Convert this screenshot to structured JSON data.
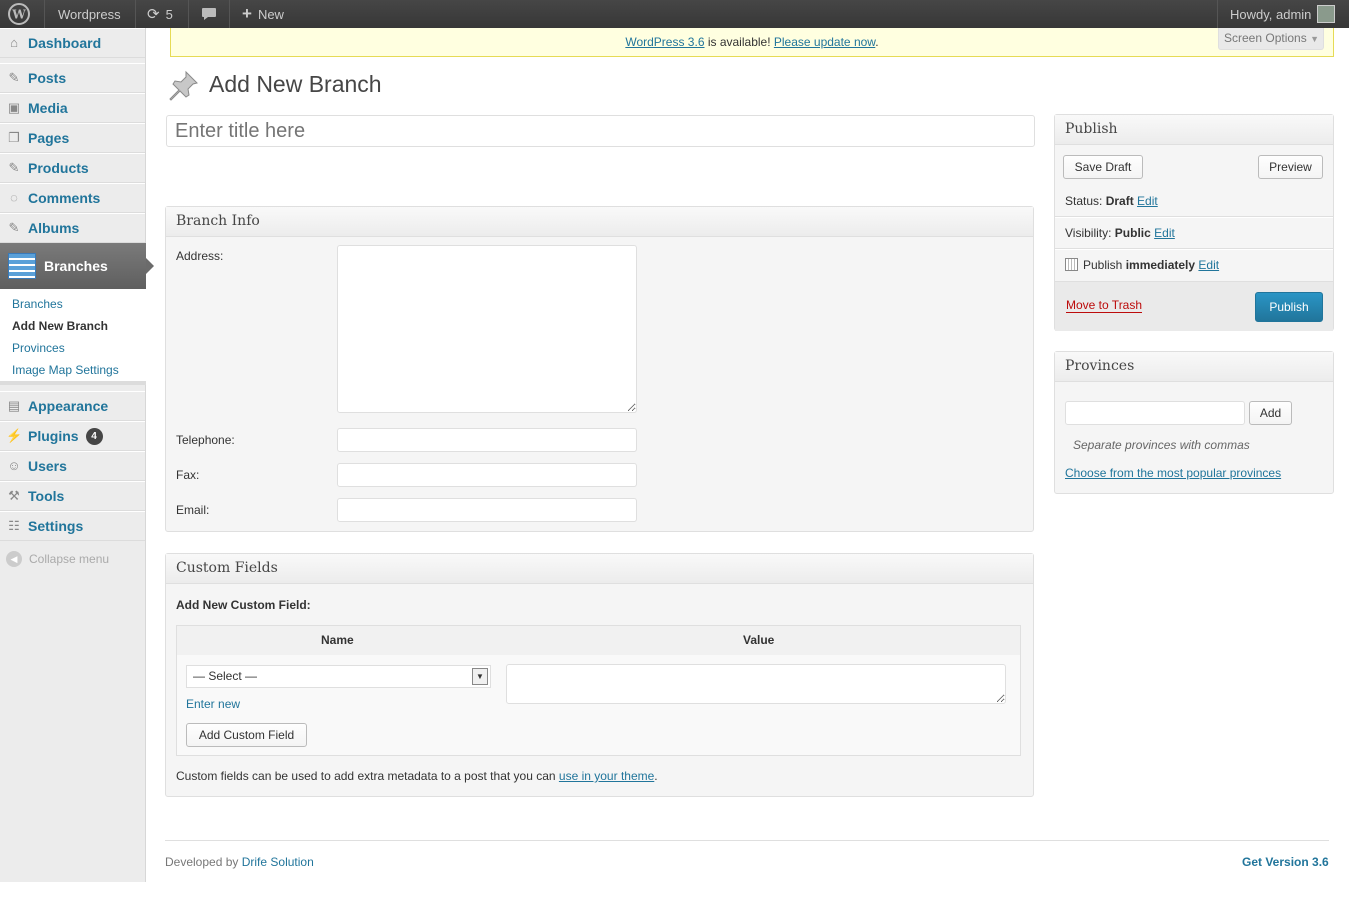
{
  "adminbar": {
    "site": "Wordpress",
    "updates": "5",
    "new": "New",
    "howdy": "Howdy, admin"
  },
  "sidebar": {
    "items": [
      {
        "label": "Dashboard",
        "icon": "dashboard-icon"
      },
      {
        "label": "Posts",
        "icon": "pin-icon"
      },
      {
        "label": "Media",
        "icon": "media-icon"
      },
      {
        "label": "Pages",
        "icon": "pages-icon"
      },
      {
        "label": "Products",
        "icon": "pin-icon"
      },
      {
        "label": "Comments",
        "icon": "comments-icon"
      },
      {
        "label": "Albums",
        "icon": "pin-icon"
      },
      {
        "label": "Branches",
        "icon": "branches-icon"
      },
      {
        "label": "Appearance",
        "icon": "appearance-icon"
      },
      {
        "label": "Plugins",
        "icon": "plugins-icon",
        "badge": "4"
      },
      {
        "label": "Users",
        "icon": "users-icon"
      },
      {
        "label": "Tools",
        "icon": "tools-icon"
      },
      {
        "label": "Settings",
        "icon": "settings-icon"
      }
    ],
    "submenu": [
      "Branches",
      "Add New Branch",
      "Provinces",
      "Image Map Settings"
    ],
    "collapse": "Collapse menu"
  },
  "notice": {
    "link1": "WordPress 3.6",
    "middle": " is available! ",
    "link2": "Please update now",
    "end": "."
  },
  "screen_options": "Screen Options",
  "page_title": "Add New Branch",
  "title_placeholder": "Enter title here",
  "branch_info": {
    "heading": "Branch Info",
    "address": "Address:",
    "telephone": "Telephone:",
    "fax": "Fax:",
    "email": "Email:"
  },
  "custom_fields": {
    "heading": "Custom Fields",
    "add_new": "Add New Custom Field:",
    "col_name": "Name",
    "col_value": "Value",
    "select": "— Select —",
    "enter_new": "Enter new",
    "add_button": "Add Custom Field",
    "help_prefix": "Custom fields can be used to add extra metadata to a post that you can ",
    "help_link": "use in your theme",
    "help_suffix": "."
  },
  "publish": {
    "heading": "Publish",
    "save_draft": "Save Draft",
    "preview": "Preview",
    "status_label": "Status: ",
    "status_value": "Draft",
    "visibility_label": "Visibility: ",
    "visibility_value": "Public",
    "publish_label": "Publish ",
    "publish_value": "immediately",
    "edit": "Edit",
    "trash": "Move to Trash",
    "publish_button": "Publish"
  },
  "provinces": {
    "heading": "Provinces",
    "add": "Add",
    "hint": "Separate provinces with commas",
    "popular": "Choose from the most popular provinces"
  },
  "footer": {
    "prefix": "Developed by ",
    "link": "Drife Solution",
    "version": "Get Version 3.6"
  },
  "colors": {
    "link": "#21759b",
    "active_menu": "#777777",
    "publish_button": "#2a95c5",
    "trash": "#bc0b0b"
  }
}
